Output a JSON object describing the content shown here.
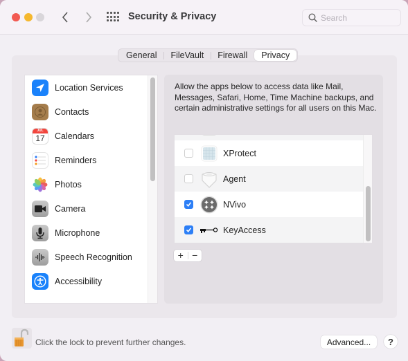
{
  "window": {
    "title": "Security & Privacy",
    "search_placeholder": "Search"
  },
  "tabs": [
    {
      "label": "General",
      "active": false
    },
    {
      "label": "FileVault",
      "active": false
    },
    {
      "label": "Firewall",
      "active": false
    },
    {
      "label": "Privacy",
      "active": true
    }
  ],
  "categories": [
    {
      "label": "Location Services",
      "icon": "location-icon"
    },
    {
      "label": "Contacts",
      "icon": "contacts-icon"
    },
    {
      "label": "Calendars",
      "icon": "calendar-icon",
      "calendar_month": "JUL",
      "calendar_day": "17"
    },
    {
      "label": "Reminders",
      "icon": "reminders-icon"
    },
    {
      "label": "Photos",
      "icon": "photos-icon"
    },
    {
      "label": "Camera",
      "icon": "camera-icon"
    },
    {
      "label": "Microphone",
      "icon": "microphone-icon"
    },
    {
      "label": "Speech Recognition",
      "icon": "speech-icon"
    },
    {
      "label": "Accessibility",
      "icon": "accessibility-icon"
    }
  ],
  "description": "Allow the apps below to access data like Mail, Messages, Safari, Home, Time Machine backups, and certain administrative settings for all users on this Mac.",
  "apps": [
    {
      "name": "XProtect",
      "checked": false,
      "icon": "xprotect-icon"
    },
    {
      "name": "Agent",
      "checked": false,
      "icon": "agent-icon"
    },
    {
      "name": "NVivo",
      "checked": true,
      "icon": "nvivo-icon"
    },
    {
      "name": "KeyAccess",
      "checked": true,
      "icon": "key-icon"
    }
  ],
  "list_controls": {
    "add": "+",
    "remove": "−"
  },
  "footer": {
    "lock_text": "Click the lock to prevent further changes.",
    "advanced_label": "Advanced...",
    "help_label": "?"
  },
  "colors": {
    "accent": "#2d7ff6",
    "close": "#f25a52",
    "minimize": "#f5b82e"
  }
}
